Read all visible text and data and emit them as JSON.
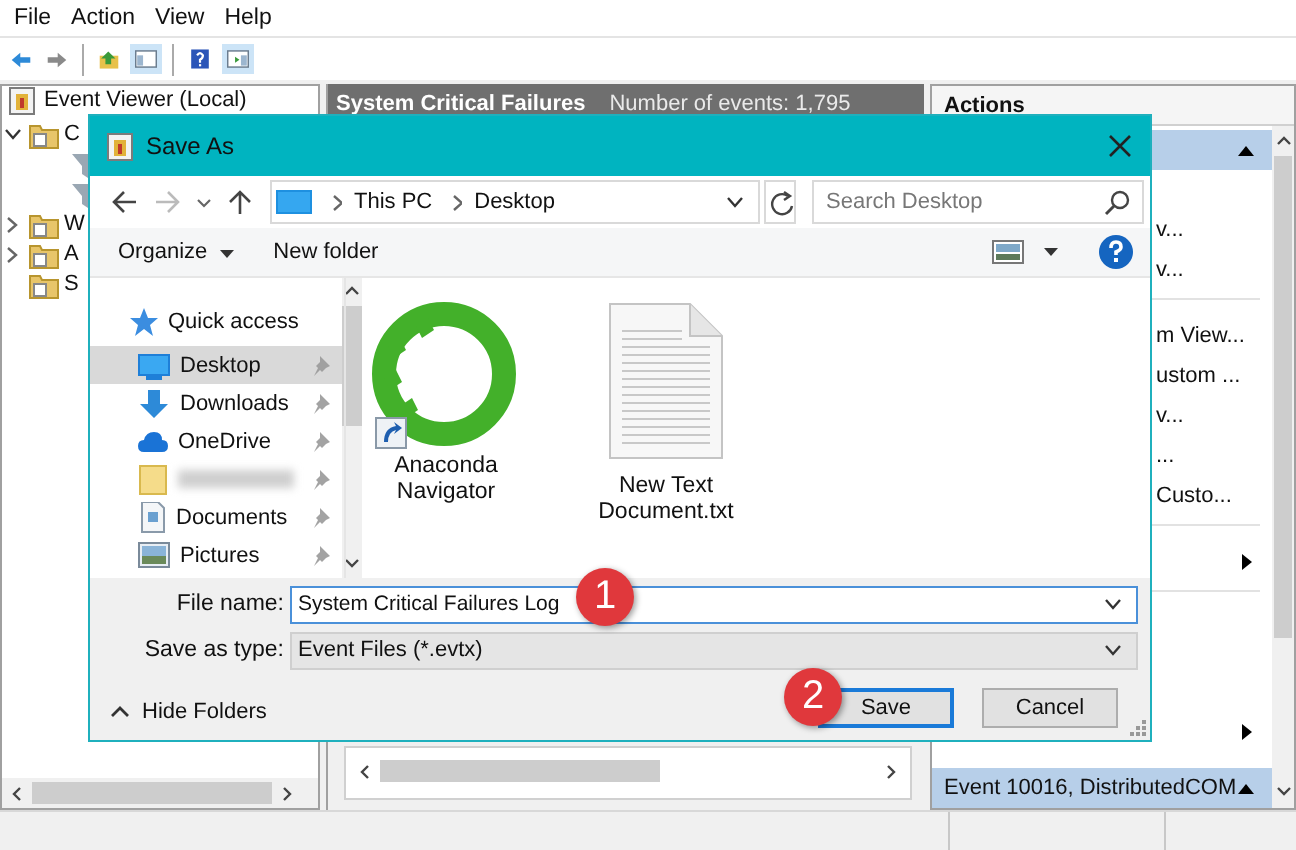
{
  "menu": [
    "File",
    "Action",
    "View",
    "Help"
  ],
  "tree": {
    "label": "Event Viewer (Local)",
    "children": [
      {
        "label": "C",
        "expanded": true,
        "children": [
          {
            "kind": "filter"
          },
          {
            "kind": "filter"
          }
        ]
      },
      {
        "label": "W",
        "expanded": false
      },
      {
        "label": "A",
        "expanded": false
      },
      {
        "label": "S"
      }
    ]
  },
  "results": {
    "title": "System Critical Failures",
    "count": "Number of events: 1,795"
  },
  "actions": {
    "title": "Actions",
    "sections": [
      {
        "expanded": true,
        "groups": [
          {
            "items": [
              {
                "label": "v..."
              },
              {
                "label": "v..."
              }
            ]
          },
          {
            "items": [
              {
                "label": "m View..."
              },
              {
                "label": "ustom ..."
              },
              {
                "label": "v..."
              },
              {
                "label": "..."
              },
              {
                "label": "Custo..."
              }
            ]
          },
          {
            "items": [
              {
                "kind": "submenu"
              }
            ]
          },
          {
            "items": [
              {
                "kind": "submenu"
              }
            ]
          }
        ]
      },
      {
        "title": "Event 10016, DistributedCOM",
        "expanded": true
      }
    ]
  },
  "dialog": {
    "title": "Save As",
    "breadcrumb": [
      "This PC",
      "Desktop"
    ],
    "search": {
      "placeholder": "Search Desktop"
    },
    "organize": "Organize",
    "new_folder": "New folder",
    "nav": [
      {
        "kind": "star",
        "label": "Quick access",
        "selected": false,
        "pinned": false
      },
      {
        "kind": "desktop",
        "label": "Desktop",
        "selected": true,
        "pinned": true
      },
      {
        "kind": "download",
        "label": "Downloads",
        "selected": false,
        "pinned": true
      },
      {
        "kind": "cloud",
        "label": "OneDrive",
        "selected": false,
        "pinned": true
      },
      {
        "kind": "folder",
        "redacted": true,
        "selected": false,
        "pinned": true
      },
      {
        "kind": "document",
        "label": "Documents",
        "selected": false,
        "pinned": true
      },
      {
        "kind": "picture",
        "label": "Pictures",
        "selected": false,
        "pinned": true
      }
    ],
    "files": [
      {
        "kind": "shortcut",
        "name": "Anaconda Navigator"
      },
      {
        "kind": "text",
        "name": "New Text Document.txt"
      }
    ],
    "file_name": {
      "label": "File name:",
      "value": "System Critical Failures Log"
    },
    "save_type": {
      "label": "Save as type:",
      "value": "Event Files (*.evtx)"
    },
    "hide_folders": "Hide Folders",
    "buttons": [
      {
        "label": "Save",
        "default": true
      },
      {
        "label": "Cancel",
        "default": false
      }
    ],
    "steps": [
      "1",
      "2"
    ]
  }
}
